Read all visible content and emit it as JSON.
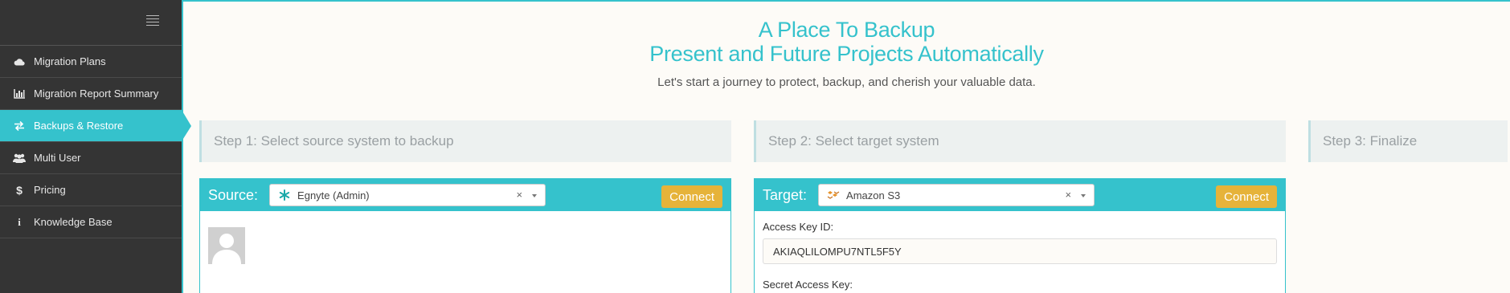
{
  "sidebar": {
    "items": [
      {
        "label": "Migration Plans",
        "icon": "cloud-icon"
      },
      {
        "label": "Migration Report Summary",
        "icon": "bar-chart-icon"
      },
      {
        "label": "Backups & Restore",
        "icon": "exchange-icon",
        "active": true
      },
      {
        "label": "Multi User",
        "icon": "users-icon"
      },
      {
        "label": "Pricing",
        "icon": "dollar-icon"
      },
      {
        "label": "Knowledge Base",
        "icon": "info-icon"
      }
    ]
  },
  "hero": {
    "title_line1": "A Place To Backup",
    "title_line2": "Present and Future Projects Automatically",
    "subtitle": "Let's start a journey to protect, backup, and cherish your valuable data."
  },
  "steps": [
    "Step 1: Select source system to backup",
    "Step 2: Select target system",
    "Step 3: Finalize"
  ],
  "source": {
    "label": "Source:",
    "selected": "Egnyte (Admin)",
    "clear": "×",
    "connect_label": "Connect"
  },
  "target": {
    "label": "Target:",
    "selected": "Amazon S3",
    "clear": "×",
    "connect_label": "Connect",
    "access_key_label": "Access Key ID:",
    "access_key_value": "AKIAQLILOMPU7NTL5F5Y",
    "secret_key_label": "Secret Access Key:"
  },
  "colors": {
    "accent": "#35c2cc",
    "sidebar_bg": "#343434",
    "connect_button": "#e6b33a"
  }
}
